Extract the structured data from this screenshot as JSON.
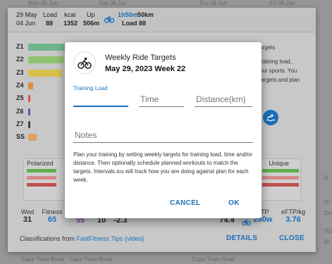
{
  "background": {
    "top_days": [
      "Mon 05 Jun",
      "Tue 06 Jun",
      "Thu 08 Jun",
      "Fri 09 Jun"
    ],
    "bottom_cells": [
      "Cape Town Road",
      "Cape Town Road",
      "Cape Town Road"
    ],
    "right_edge": [
      "6t",
      "3h",
      "154",
      "761",
      "3x"
    ]
  },
  "summary": {
    "date_start": "29 May",
    "date_end": "04 Jun",
    "load_label": "Load",
    "load_value": "88",
    "kcal_label": "kcal",
    "kcal_value": "1352",
    "up_label": "Up",
    "up_value": "506m",
    "ride_time": "1h50m",
    "ride_dist": "50km",
    "ride_load": "Load 88"
  },
  "zones": [
    {
      "label": "Z1",
      "value": 0.95,
      "color": "#6fb58a"
    },
    {
      "label": "Z2",
      "value": 0.9,
      "color": "#8fc36e"
    },
    {
      "label": "Z3",
      "value": 0.88,
      "color": "#d8c04a"
    },
    {
      "label": "Z4",
      "value": 0.12,
      "color": "#e09040"
    },
    {
      "label": "Z5",
      "value": 0.05,
      "color": "#d95040"
    },
    {
      "label": "Z6",
      "value": 0.04,
      "color": "#7050b0"
    },
    {
      "label": "Z7",
      "value": 0.03,
      "color": "#404040"
    },
    {
      "label": "SS",
      "value": 0.22,
      "color": "#e0a060"
    }
  ],
  "side_text": [
    "argets",
    "training load,",
    "our sports. You",
    "targets and plan"
  ],
  "polarization": {
    "left_label": "Polarized",
    "right_label": "Unique"
  },
  "metrics": [
    {
      "label": "Wed",
      "value": "31"
    },
    {
      "label": "Fitness",
      "value": "65"
    },
    {
      "label": "",
      "value": "55"
    },
    {
      "label": "",
      "value": "10"
    },
    {
      "label": "",
      "value": "-2.3"
    },
    {
      "label": "",
      "value": "74.4"
    },
    {
      "label": "FTP",
      "value": "280w"
    },
    {
      "label": "eFTP/kg",
      "value": "3.76"
    }
  ],
  "footer": {
    "classifications_prefix": "Classifications from ",
    "classifications_link": "FastFitness.Tips",
    "classifications_video": "(video)",
    "details": "DETAILS",
    "close": "CLOSE"
  },
  "dialog": {
    "title": "Weekly Ride Targets",
    "subtitle": "May 29, 2023 Week 22",
    "training_load_label": "Training Load",
    "time_placeholder": "Time",
    "distance_placeholder": "Distance(km)",
    "notes_placeholder": "Notes",
    "description": "Plan your training by setting weekly targets for training load, time and/or distance. Then optionally schedule planned workouts to match the targets. Intervals.icu will track how you are doing against plan for each week.",
    "cancel": "CANCEL",
    "ok": "OK",
    "accent": "#1a6fb8"
  }
}
